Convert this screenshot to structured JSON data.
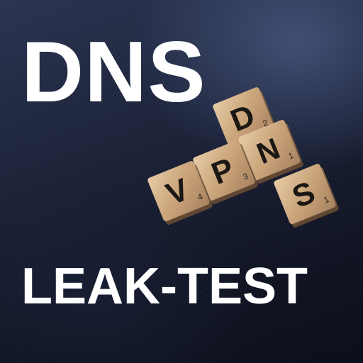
{
  "title_top": "DNS",
  "title_bottom": "LEAK-TEST",
  "tiles": [
    {
      "letter": "D",
      "value": "2"
    },
    {
      "letter": "N",
      "value": "1"
    },
    {
      "letter": "S",
      "value": "1"
    },
    {
      "letter": "V",
      "value": "4"
    },
    {
      "letter": "P",
      "value": "3"
    }
  ],
  "colors": {
    "background": "#141a2c",
    "text": "#ffffff",
    "tile_wood": "#c9a47c",
    "tile_ink": "#1a1714"
  }
}
